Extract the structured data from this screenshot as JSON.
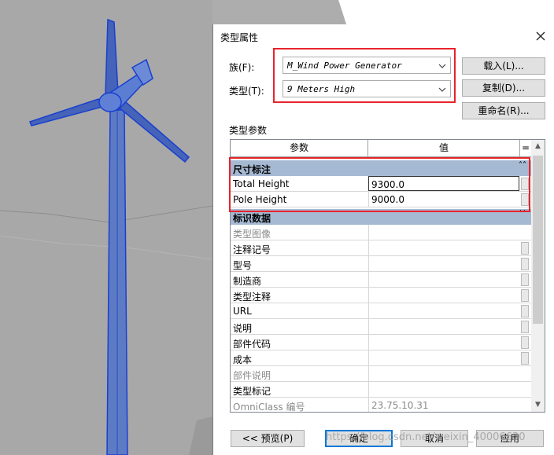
{
  "dialog": {
    "title": "类型属性",
    "family_label": "族(F):",
    "family_value": "M_Wind Power Generator",
    "type_label": "类型(T):",
    "type_value": "9 Meters High",
    "load_button": "载入(L)...",
    "duplicate_button": "复制(D)...",
    "rename_button": "重命名(R)...",
    "section_label": "类型参数",
    "grid": {
      "col_param": "参数",
      "col_value": "值",
      "col_eq": "=",
      "groups": [
        {
          "title": "尺寸标注",
          "rows": [
            {
              "param": "Total Height",
              "value": "9300.0"
            },
            {
              "param": "Pole Height",
              "value": "9000.0"
            }
          ]
        },
        {
          "title": "标识数据",
          "rows": [
            {
              "param": "类型图像",
              "value": ""
            },
            {
              "param": "注释记号",
              "value": ""
            },
            {
              "param": "型号",
              "value": ""
            },
            {
              "param": "制造商",
              "value": ""
            },
            {
              "param": "类型注释",
              "value": ""
            },
            {
              "param": "URL",
              "value": ""
            },
            {
              "param": "说明",
              "value": ""
            },
            {
              "param": "部件代码",
              "value": ""
            },
            {
              "param": "成本",
              "value": ""
            },
            {
              "param": "部件说明",
              "value": ""
            },
            {
              "param": "类型标记",
              "value": ""
            },
            {
              "param": "OmniClass 编号",
              "value": "23.75.10.31"
            }
          ]
        }
      ]
    },
    "preview_button": "<< 预览(P)",
    "ok_button": "确定",
    "cancel_button": "取消",
    "apply_button": "应用",
    "watermark": "https://blog.csdn.net/weixin_40006630"
  },
  "colors": {
    "highlight": "#e8232b",
    "group_header": "#a6b9d3",
    "model_blue": "#2e57c8"
  }
}
